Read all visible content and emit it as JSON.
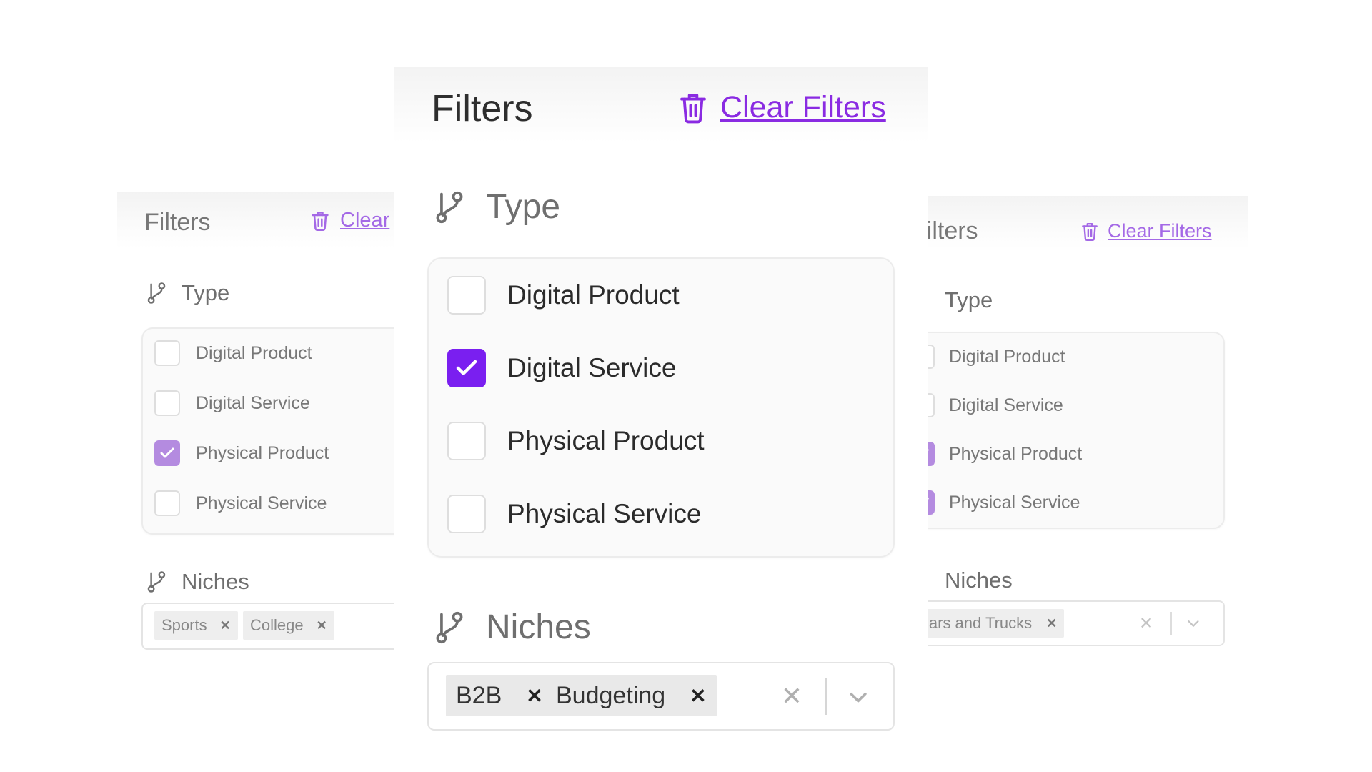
{
  "colors": {
    "accent": "#7a1ff0",
    "link": "#8a2be2",
    "border": "#e4e4e4",
    "panel_header_bg": "#f3f3f3"
  },
  "icons": {
    "clear": "trash-icon",
    "section": "branch-icon",
    "remove_chip": "close-icon",
    "dropdown": "chevron-down-icon"
  },
  "left": {
    "title": "Filters",
    "clear_label": "Clear",
    "type_label": "Type",
    "options": [
      {
        "label": "Digital Product",
        "checked": false
      },
      {
        "label": "Digital Service",
        "checked": false
      },
      {
        "label": "Physical Product",
        "checked": true
      },
      {
        "label": "Physical Service",
        "checked": false
      }
    ],
    "niches_label": "Niches",
    "chips": [
      {
        "label": "Sports"
      },
      {
        "label": "College"
      }
    ]
  },
  "center": {
    "title": "Filters",
    "clear_label": "Clear Filters",
    "type_label": "Type",
    "options": [
      {
        "label": "Digital Product",
        "checked": false
      },
      {
        "label": "Digital Service",
        "checked": true
      },
      {
        "label": "Physical Product",
        "checked": false
      },
      {
        "label": "Physical Service",
        "checked": false
      }
    ],
    "niches_label": "Niches",
    "chips": [
      {
        "label": "B2B"
      },
      {
        "label": "Budgeting"
      }
    ]
  },
  "right": {
    "title": "Filters",
    "clear_label": "Clear Filters",
    "type_label": "Type",
    "options": [
      {
        "label": "Digital Product",
        "checked": false
      },
      {
        "label": "Digital Service",
        "checked": false
      },
      {
        "label": "Physical Product",
        "checked": true
      },
      {
        "label": "Physical Service",
        "checked": true
      }
    ],
    "niches_label": "Niches",
    "chips": [
      {
        "label": "Cars and Trucks"
      }
    ]
  }
}
